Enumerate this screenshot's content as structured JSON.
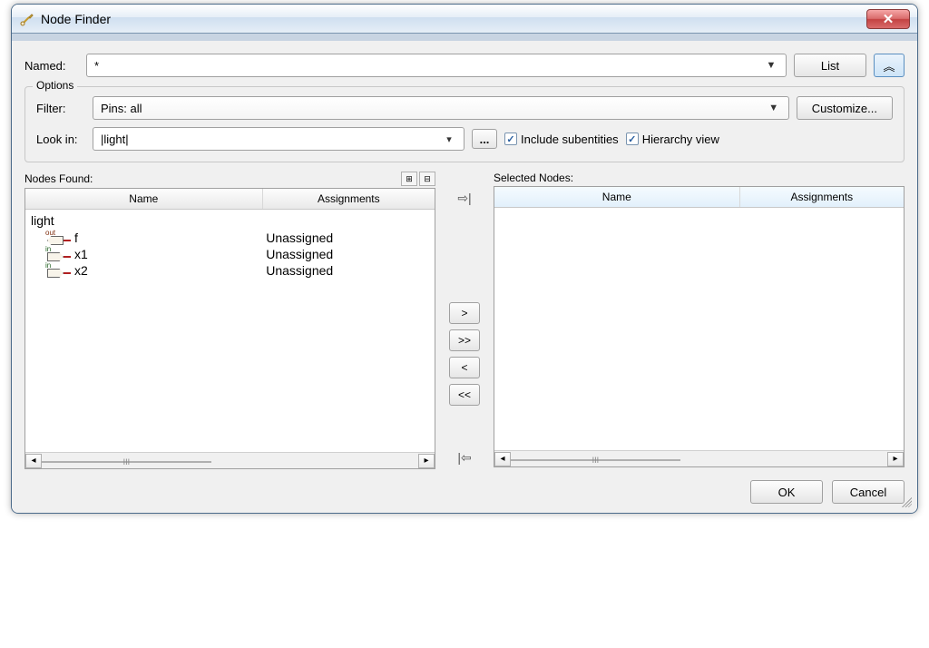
{
  "title": "Node Finder",
  "close_glyph": "✕",
  "named": {
    "label": "Named:",
    "value": "*",
    "list_btn": "List"
  },
  "collapse_glyph": "︽",
  "options": {
    "legend": "Options",
    "filter_label": "Filter:",
    "filter_value": "Pins: all",
    "customize_btn": "Customize...",
    "lookin_label": "Look in:",
    "lookin_value": "|light|",
    "browse_btn": "...",
    "include_sub": "Include subentities",
    "hierarchy_view": "Hierarchy view"
  },
  "found": {
    "caption": "Nodes Found:",
    "expand_tip": "+",
    "collapse_tip": "−",
    "cols": {
      "name": "Name",
      "assign": "Assignments"
    },
    "root": "light",
    "rows": [
      {
        "dir": "out",
        "name": "f",
        "assign": "Unassigned"
      },
      {
        "dir": "in",
        "name": "x1",
        "assign": "Unassigned"
      },
      {
        "dir": "in",
        "name": "x2",
        "assign": "Unassigned"
      }
    ]
  },
  "selected": {
    "caption": "Selected Nodes:",
    "cols": {
      "name": "Name",
      "assign": "Assignments"
    }
  },
  "xfer": {
    "copy_sel_icon": "⇨|",
    "add": ">",
    "add_all": ">>",
    "remove": "<",
    "remove_all": "<<",
    "copy_back_icon": "|⇦"
  },
  "scroll_thumb_glyph": "III",
  "buttons": {
    "ok": "OK",
    "cancel": "Cancel"
  }
}
